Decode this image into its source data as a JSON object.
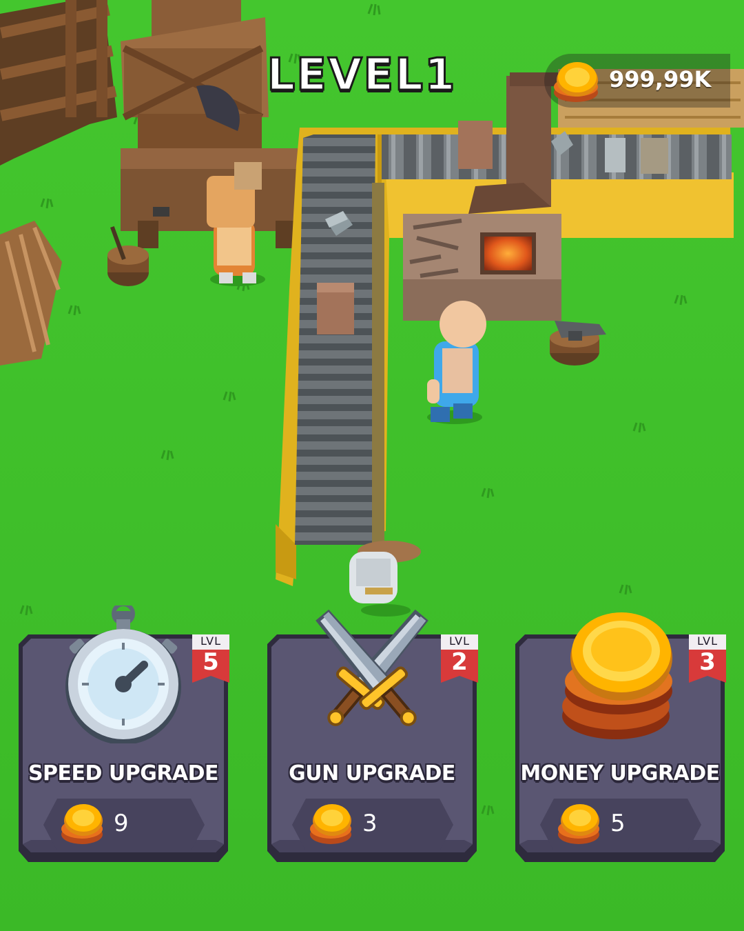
{
  "hud": {
    "level_label": "LEVEL1",
    "currency_value": "999,99K",
    "currency_icon": "coin-stack-icon"
  },
  "upgrades": [
    {
      "title": "SPEED UPGRADE",
      "level_label": "LVL",
      "level": "5",
      "cost": "9",
      "icon": "stopwatch-icon"
    },
    {
      "title": "GUN UPGRADE",
      "level_label": "LVL",
      "level": "2",
      "cost": "3",
      "icon": "crossed-swords-icon"
    },
    {
      "title": "MONEY UPGRADE",
      "level_label": "LVL",
      "level": "3",
      "cost": "5",
      "icon": "coin-stack-icon"
    }
  ],
  "colors": {
    "grass": "#3fc12a",
    "card_panel": "#5a5672",
    "card_border": "#2e2b3d",
    "level_ribbon": "#d83a3a",
    "coin_gold": "#ffb400",
    "conveyor_frame": "#e0b21e"
  }
}
